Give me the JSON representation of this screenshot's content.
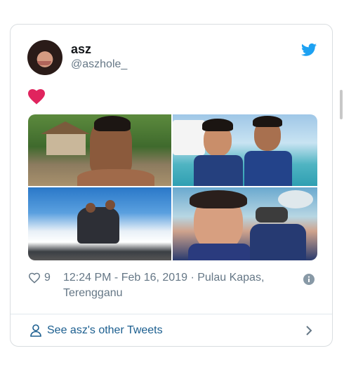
{
  "tweet": {
    "author_name": "asz",
    "author_handle": "@aszhole_",
    "body_emoji": "heart-emoji",
    "like_count": "9",
    "timestamp_location": "12:24 PM - Feb 16, 2019 · Pulau Kapas, Terengganu",
    "see_more_label": "See asz's other Tweets"
  },
  "icons": {
    "brand": "twitter-bird-icon",
    "like": "heart-outline-icon",
    "info": "info-icon",
    "profile": "person-icon",
    "chevron": "chevron-right-icon"
  },
  "colors": {
    "twitter_blue": "#1da1f2",
    "link_blue": "#1b5e8f",
    "heart_red": "#e0245e",
    "muted_text": "#657786"
  }
}
